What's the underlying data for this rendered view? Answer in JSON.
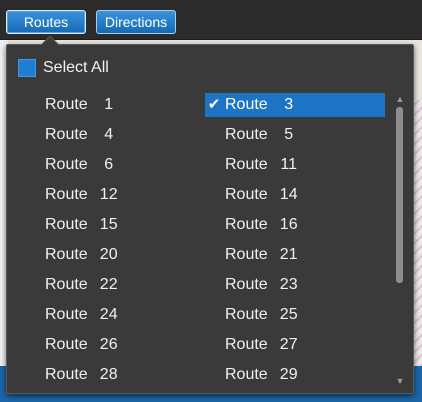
{
  "toolbar": {
    "routes_label": "Routes",
    "directions_label": "Directions"
  },
  "panel": {
    "select_all_label": "Select All",
    "route_word": "Route",
    "left_column": [
      {
        "num": "1",
        "selected": false
      },
      {
        "num": "4",
        "selected": false
      },
      {
        "num": "6",
        "selected": false
      },
      {
        "num": "12",
        "selected": false
      },
      {
        "num": "15",
        "selected": false
      },
      {
        "num": "20",
        "selected": false
      },
      {
        "num": "22",
        "selected": false
      },
      {
        "num": "24",
        "selected": false
      },
      {
        "num": "26",
        "selected": false
      },
      {
        "num": "28",
        "selected": false
      }
    ],
    "right_column": [
      {
        "num": "3",
        "selected": true
      },
      {
        "num": "5",
        "selected": false
      },
      {
        "num": "11",
        "selected": false
      },
      {
        "num": "14",
        "selected": false
      },
      {
        "num": "16",
        "selected": false
      },
      {
        "num": "21",
        "selected": false
      },
      {
        "num": "23",
        "selected": false
      },
      {
        "num": "25",
        "selected": false
      },
      {
        "num": "27",
        "selected": false
      },
      {
        "num": "29",
        "selected": false
      }
    ],
    "check_glyph": "✔",
    "scroll_up_glyph": "▲",
    "scroll_down_glyph": "▼"
  },
  "colors": {
    "accent": "#1e74c4",
    "panel_bg": "#3a3a3a",
    "toolbar_bg": "#2b2b2b"
  }
}
